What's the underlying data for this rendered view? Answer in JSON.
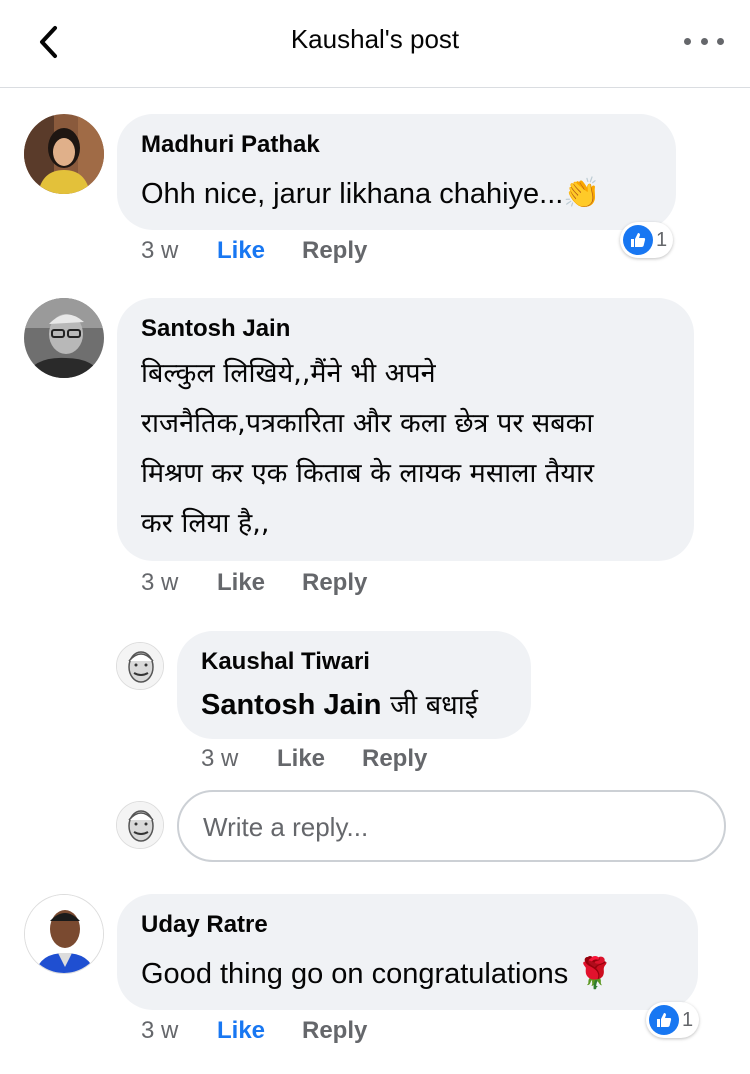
{
  "header": {
    "title": "Kaushal's post"
  },
  "comments": [
    {
      "author": "Madhuri Pathak",
      "text": "Ohh nice, jarur likhana chahiye...",
      "emoji": "👏",
      "time": "3 w",
      "like_label": "Like",
      "reply_label": "Reply",
      "reaction_count": "1"
    },
    {
      "author": "Santosh Jain",
      "text_lines": [
        "बिल्कुल लिखिये,,मैंने भी अपने",
        "राजनैतिक,पत्रकारिता और कला छेत्र पर सबका",
        "मिश्रण कर एक किताब के लायक मसाला तैयार",
        "कर लिया है,,"
      ],
      "time": "3 w",
      "like_label": "Like",
      "reply_label": "Reply"
    },
    {
      "author": "Uday Ratre",
      "text": "Good thing go on congratulations",
      "emoji": "🌹",
      "time": "3 w",
      "like_label": "Like",
      "reply_label": "Reply",
      "reaction_count": "1"
    }
  ],
  "reply": {
    "author": "Kaushal Tiwari",
    "mention": "Santosh Jain",
    "text": " जी बधाई",
    "time": "3 w",
    "like_label": "Like",
    "reply_label": "Reply"
  },
  "reply_box": {
    "placeholder": "Write a reply..."
  },
  "colors": {
    "accent": "#1877f2",
    "bubble": "#f0f2f5",
    "muted": "#65676b"
  }
}
